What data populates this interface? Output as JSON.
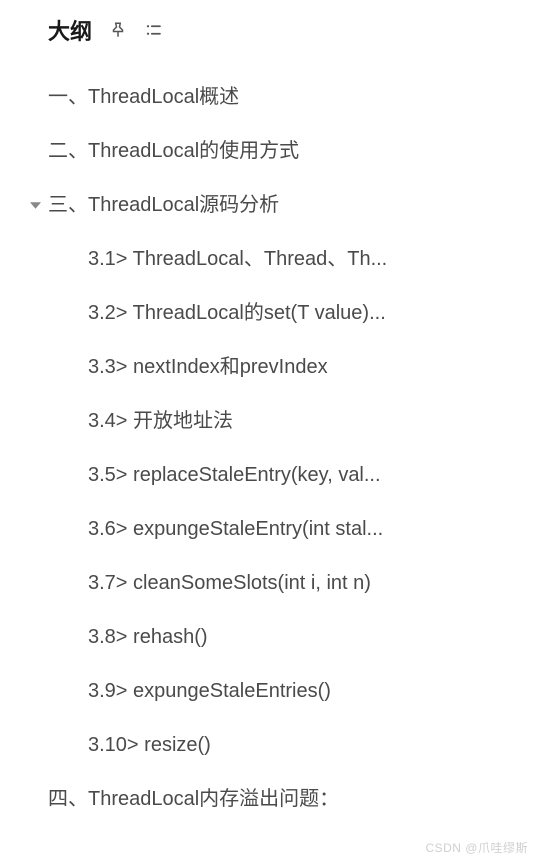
{
  "header": {
    "title": "大纲"
  },
  "outline": {
    "items": [
      {
        "label": "一、ThreadLocal概述",
        "level": 0,
        "expanded": null
      },
      {
        "label": "二、ThreadLocal的使用方式",
        "level": 0,
        "expanded": null
      },
      {
        "label": "三、ThreadLocal源码分析",
        "level": 0,
        "expanded": true
      },
      {
        "label": "3.1> ThreadLocal、Thread、Th...",
        "level": 1,
        "expanded": null
      },
      {
        "label": "3.2> ThreadLocal的set(T value)...",
        "level": 1,
        "expanded": null
      },
      {
        "label": "3.3> nextIndex和prevIndex",
        "level": 1,
        "expanded": null
      },
      {
        "label": "3.4> 开放地址法",
        "level": 1,
        "expanded": null
      },
      {
        "label": "3.5> replaceStaleEntry(key, val...",
        "level": 1,
        "expanded": null
      },
      {
        "label": "3.6> expungeStaleEntry(int stal...",
        "level": 1,
        "expanded": null
      },
      {
        "label": "3.7> cleanSomeSlots(int i, int n)",
        "level": 1,
        "expanded": null
      },
      {
        "label": "3.8> rehash()",
        "level": 1,
        "expanded": null
      },
      {
        "label": "3.9> expungeStaleEntries()",
        "level": 1,
        "expanded": null
      },
      {
        "label": "3.10> resize()",
        "level": 1,
        "expanded": null
      },
      {
        "label": "四、ThreadLocal内存溢出问题：",
        "level": 0,
        "expanded": null
      }
    ]
  },
  "watermark": "CSDN @爪哇缪斯"
}
